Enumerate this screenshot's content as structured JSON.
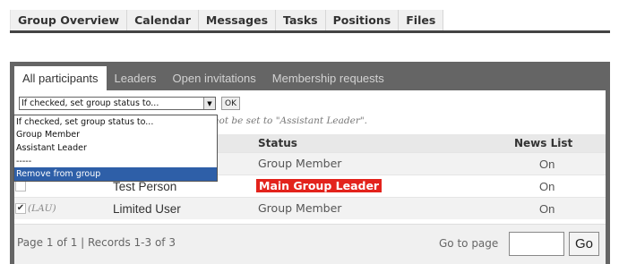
{
  "top_tabs": [
    "Group Overview",
    "Calendar",
    "Messages",
    "Tasks",
    "Positions",
    "Files"
  ],
  "sub_tabs": [
    "All participants",
    "Leaders",
    "Open invitations",
    "Membership requests"
  ],
  "action": {
    "select_value": "If checked, set group status to...",
    "ok_label": "OK",
    "note": "nnot be set to \"Assistant Leader\".",
    "dropdown_options": [
      "If checked, set group status to...",
      "Group Member",
      "Assistant Leader",
      "-----",
      "Remove from group"
    ],
    "dropdown_selected": "Remove from group"
  },
  "table": {
    "headers": {
      "status": "Status",
      "news": "News List"
    },
    "rows": [
      {
        "tag": "",
        "name": "",
        "status": "Group Member",
        "news": "On",
        "checked": false
      },
      {
        "tag": "",
        "name": "Test Person",
        "status": "Main Group Leader",
        "news": "On",
        "checked": false
      },
      {
        "tag": "(LAU)",
        "name": "Limited User",
        "status": "Group Member",
        "news": "On",
        "checked": true
      }
    ]
  },
  "footer": {
    "page_info": "Page 1 of 1  |  Records 1-3 of 3",
    "goto_label": "Go to page",
    "go_label": "Go"
  },
  "colors": {
    "panel": "#656565",
    "leader_badge": "#e3231c",
    "dropdown_highlight": "#2e5fa8"
  }
}
